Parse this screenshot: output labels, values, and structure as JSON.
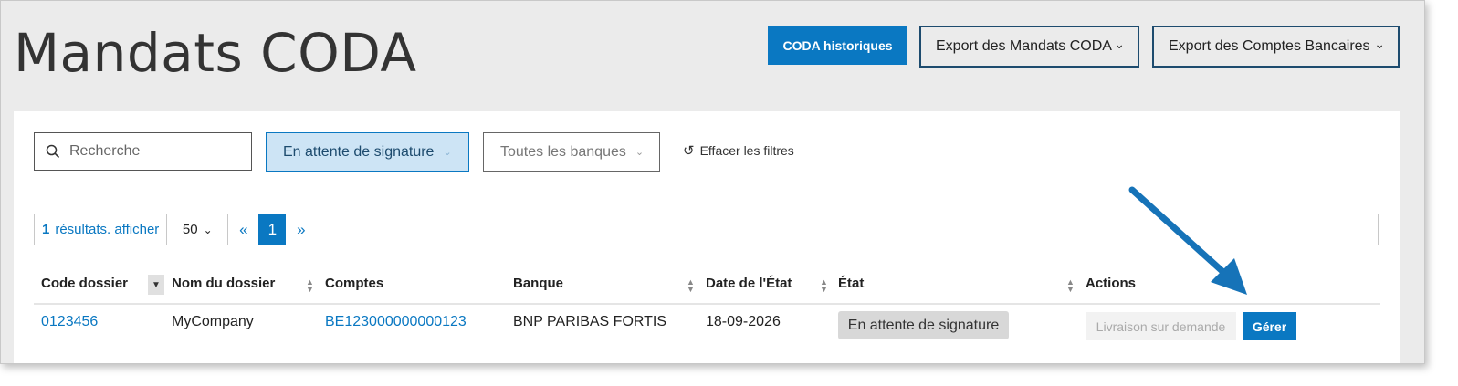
{
  "header": {
    "title": "Mandats CODA",
    "btn_history": "CODA historiques",
    "btn_export_mandates": "Export des Mandats CODA",
    "btn_export_accounts": "Export des Comptes Bancaires"
  },
  "filters": {
    "search_placeholder": "Recherche",
    "status_filter": "En attente de signature",
    "bank_filter": "Toutes les banques",
    "clear_label": "Effacer les filtres"
  },
  "pager": {
    "count": "1",
    "results_label": "résultats. afficher",
    "page_size": "50",
    "prev": "«",
    "current_page": "1",
    "next": "»"
  },
  "table": {
    "columns": [
      "Code dossier",
      "Nom du dossier",
      "Comptes",
      "Banque",
      "Date de l'État",
      "État",
      "Actions"
    ],
    "rows": [
      {
        "code": "0123456",
        "name": "MyCompany",
        "account": "BE123000000000123",
        "bank": "BNP PARIBAS FORTIS",
        "date": "18-09-2026",
        "status": "En attente de signature",
        "action_disabled": "Livraison sur demande",
        "action_manage": "Gérer"
      }
    ]
  },
  "icons": {
    "search": "search-icon",
    "chevron": "chevron-down-icon",
    "reset": "reset-icon",
    "sort": "sort-icon",
    "annotation": "annotation-arrow"
  },
  "colors": {
    "primary": "#0a78c2",
    "background": "#ebebeb",
    "filter_active": "#cde4f5"
  }
}
